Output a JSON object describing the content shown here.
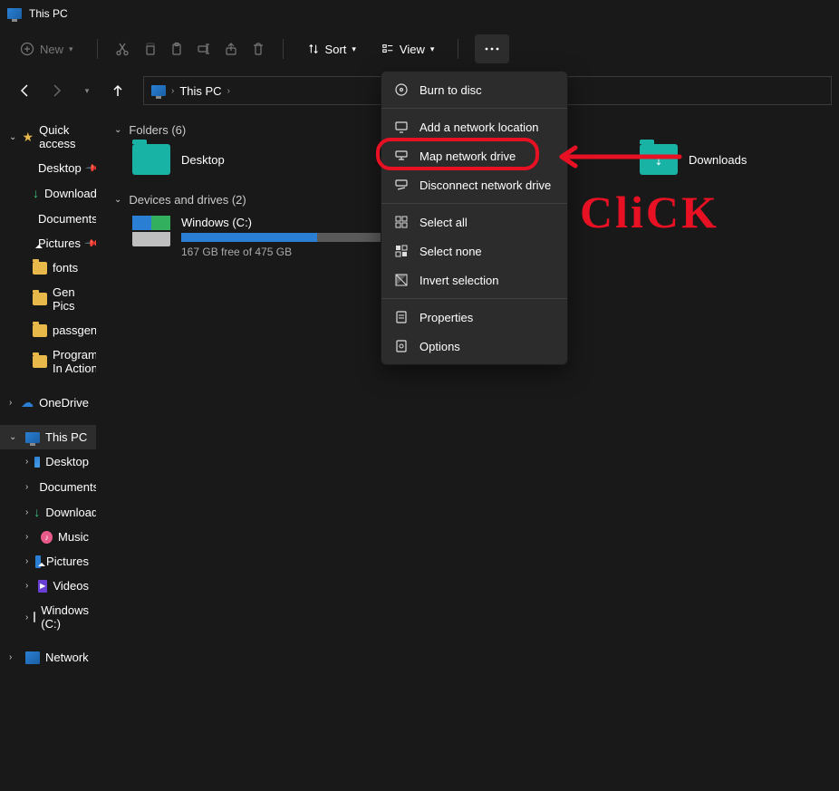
{
  "title": "This PC",
  "toolbar": {
    "new": "New",
    "sort": "Sort",
    "view": "View"
  },
  "address": {
    "location": "This PC"
  },
  "sidebar": {
    "quickAccess": "Quick access",
    "qa": [
      {
        "label": "Desktop",
        "pin": true
      },
      {
        "label": "Downloads",
        "pin": true
      },
      {
        "label": "Documents",
        "pin": true
      },
      {
        "label": "Pictures",
        "pin": true
      },
      {
        "label": "fonts",
        "pin": false
      },
      {
        "label": "Gen Pics",
        "pin": false
      },
      {
        "label": "passgen",
        "pin": false
      },
      {
        "label": "Program In Action",
        "pin": false
      }
    ],
    "oneDrive": "OneDrive",
    "thisPC": "This PC",
    "pc": [
      {
        "label": "Desktop"
      },
      {
        "label": "Documents"
      },
      {
        "label": "Downloads"
      },
      {
        "label": "Music"
      },
      {
        "label": "Pictures"
      },
      {
        "label": "Videos"
      },
      {
        "label": "Windows  (C:)"
      }
    ],
    "network": "Network"
  },
  "content": {
    "foldersHeader": "Folders (6)",
    "folders": [
      {
        "label": "Desktop"
      },
      {
        "label": "Downloads"
      }
    ],
    "drivesHeader": "Devices and drives (2)",
    "drive": {
      "label": "Windows  (C:)",
      "sub": "167 GB free of 475 GB",
      "usedPct": 65
    }
  },
  "ctx": {
    "items": [
      {
        "label": "Burn to disc"
      },
      {
        "label": "Add a network location"
      },
      {
        "label": "Map network drive"
      },
      {
        "label": "Disconnect network drive"
      },
      {
        "label": "Select all"
      },
      {
        "label": "Select none"
      },
      {
        "label": "Invert selection"
      },
      {
        "label": "Properties"
      },
      {
        "label": "Options"
      }
    ]
  },
  "annotation": {
    "clickText": "CliCK"
  }
}
